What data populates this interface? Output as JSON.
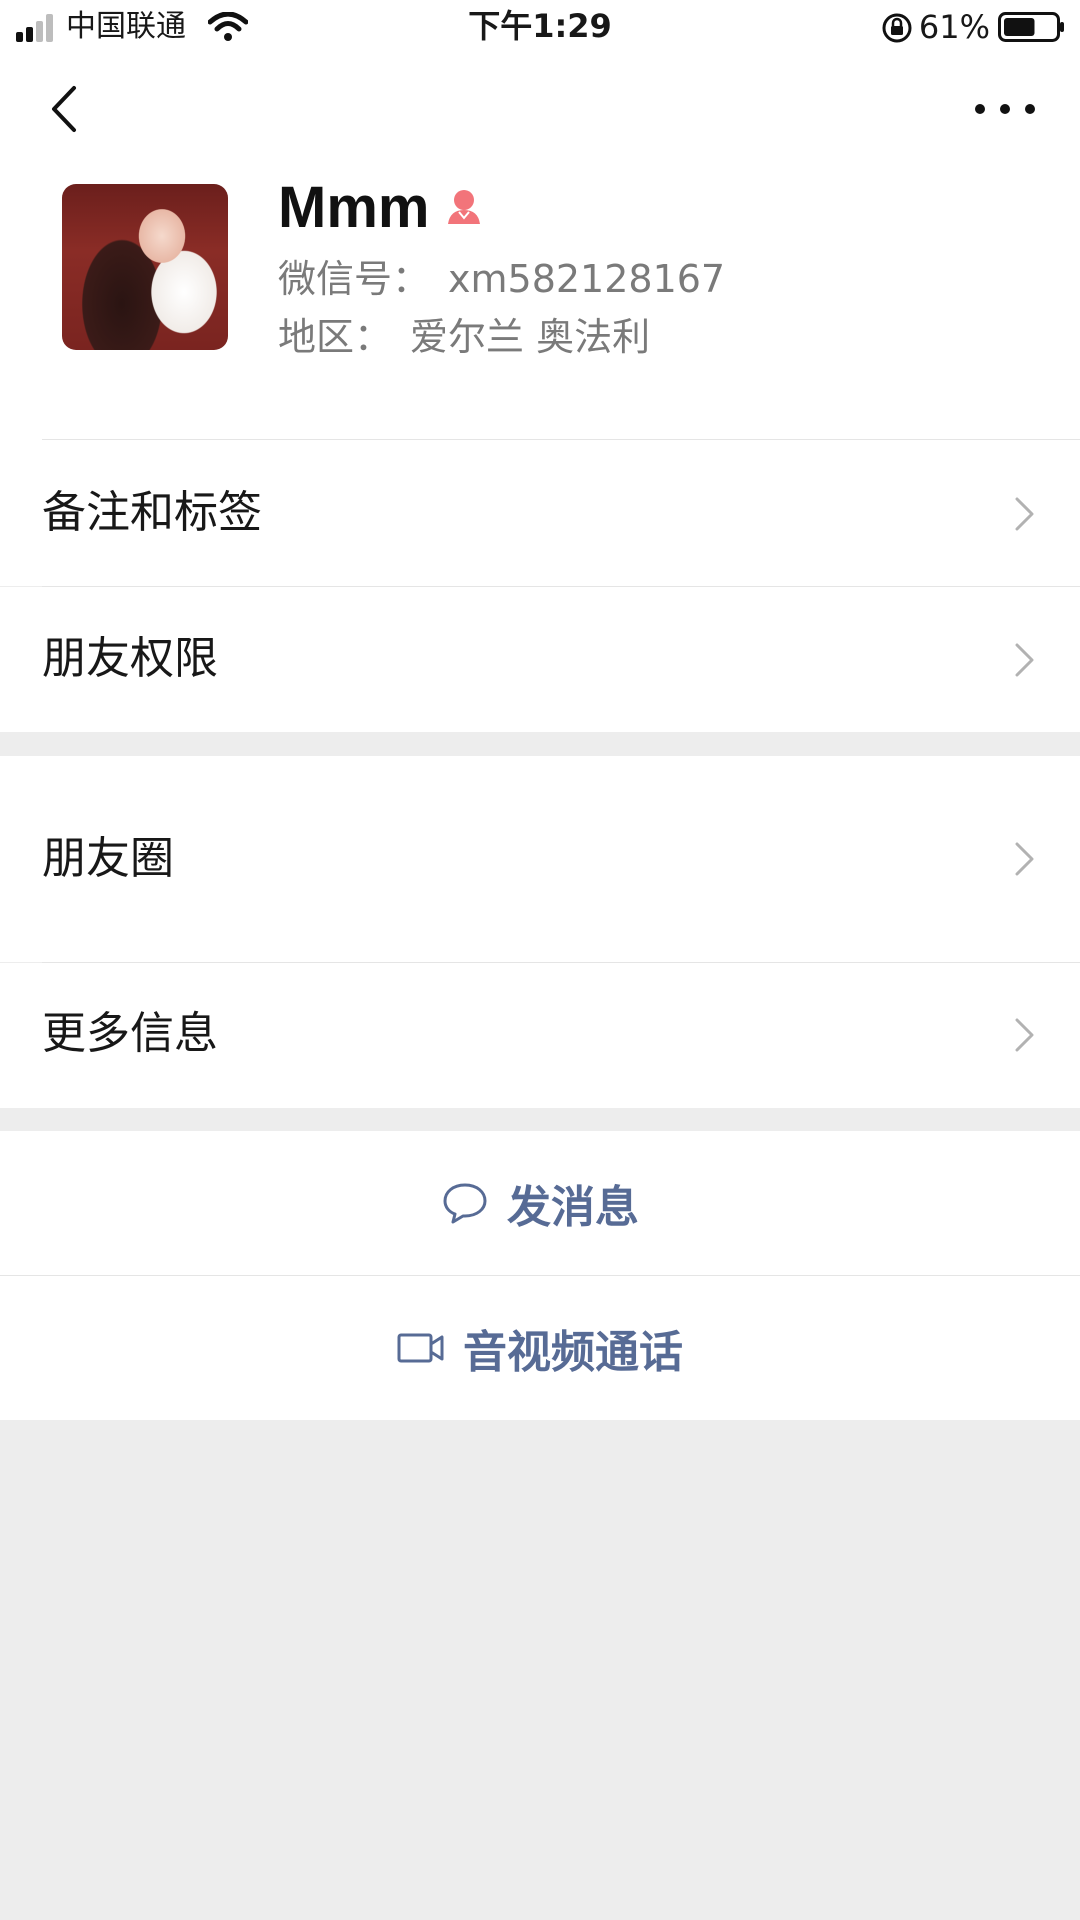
{
  "status_bar": {
    "carrier": "中国联通",
    "time": "下午1:29",
    "battery_percent": "61%",
    "battery_level": 0.61,
    "icons": [
      "signal-icon",
      "wifi-icon",
      "rotation-lock-icon",
      "battery-icon"
    ]
  },
  "nav": {
    "back_icon": "chevron-left-icon",
    "more_icon": "more-dots-icon"
  },
  "profile": {
    "name": "Mmm",
    "gender_icon": "female-icon",
    "gender_color": "#f2747a",
    "wechat_id_label": "微信号：",
    "wechat_id": "xm582128167",
    "region_label": "地区：",
    "region": "爱尔兰 奥法利"
  },
  "menu": {
    "remarks_tags": "备注和标签",
    "friend_permissions": "朋友权限",
    "moments": "朋友圈",
    "more_info": "更多信息"
  },
  "actions": {
    "send_message": "发消息",
    "voice_video_call": "音视频通话",
    "accent_color": "#576b95"
  }
}
